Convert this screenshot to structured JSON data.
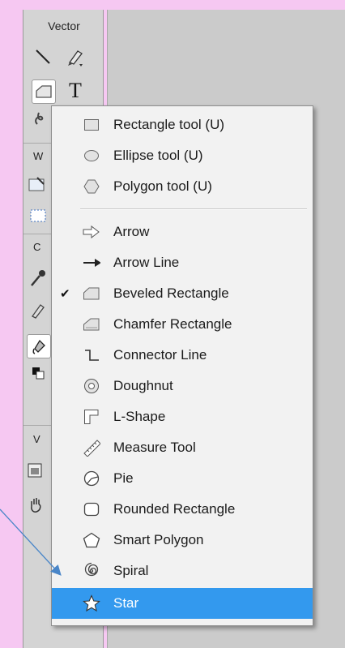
{
  "toolbar": {
    "vector_title": "Vector",
    "text_tool_glyph": "T",
    "section2_initial": "W",
    "section3_initial": "C",
    "section4_initial": "V"
  },
  "menu": {
    "items": [
      {
        "label": "Rectangle tool (U)",
        "icon": "rectangle-icon"
      },
      {
        "label": "Ellipse tool (U)",
        "icon": "ellipse-icon"
      },
      {
        "label": "Polygon tool (U)",
        "icon": "polygon-icon"
      },
      {
        "label": "Arrow",
        "icon": "arrow-icon"
      },
      {
        "label": "Arrow Line",
        "icon": "arrow-line-icon"
      },
      {
        "label": "Beveled Rectangle",
        "icon": "beveled-rectangle-icon",
        "checked": true
      },
      {
        "label": "Chamfer Rectangle",
        "icon": "chamfer-rectangle-icon"
      },
      {
        "label": "Connector Line",
        "icon": "connector-line-icon"
      },
      {
        "label": "Doughnut",
        "icon": "doughnut-icon"
      },
      {
        "label": "L-Shape",
        "icon": "l-shape-icon"
      },
      {
        "label": "Measure Tool",
        "icon": "measure-tool-icon"
      },
      {
        "label": "Pie",
        "icon": "pie-icon"
      },
      {
        "label": "Rounded Rectangle",
        "icon": "rounded-rectangle-icon"
      },
      {
        "label": "Smart Polygon",
        "icon": "smart-polygon-icon"
      },
      {
        "label": "Spiral",
        "icon": "spiral-icon"
      },
      {
        "label": "Star",
        "icon": "star-icon",
        "highlighted": true
      }
    ],
    "check_glyph": "✔",
    "highlight_color": "#3399ee"
  },
  "colors": {
    "background": "#f6c8f2",
    "annotation_arrow": "#4a86c8"
  }
}
